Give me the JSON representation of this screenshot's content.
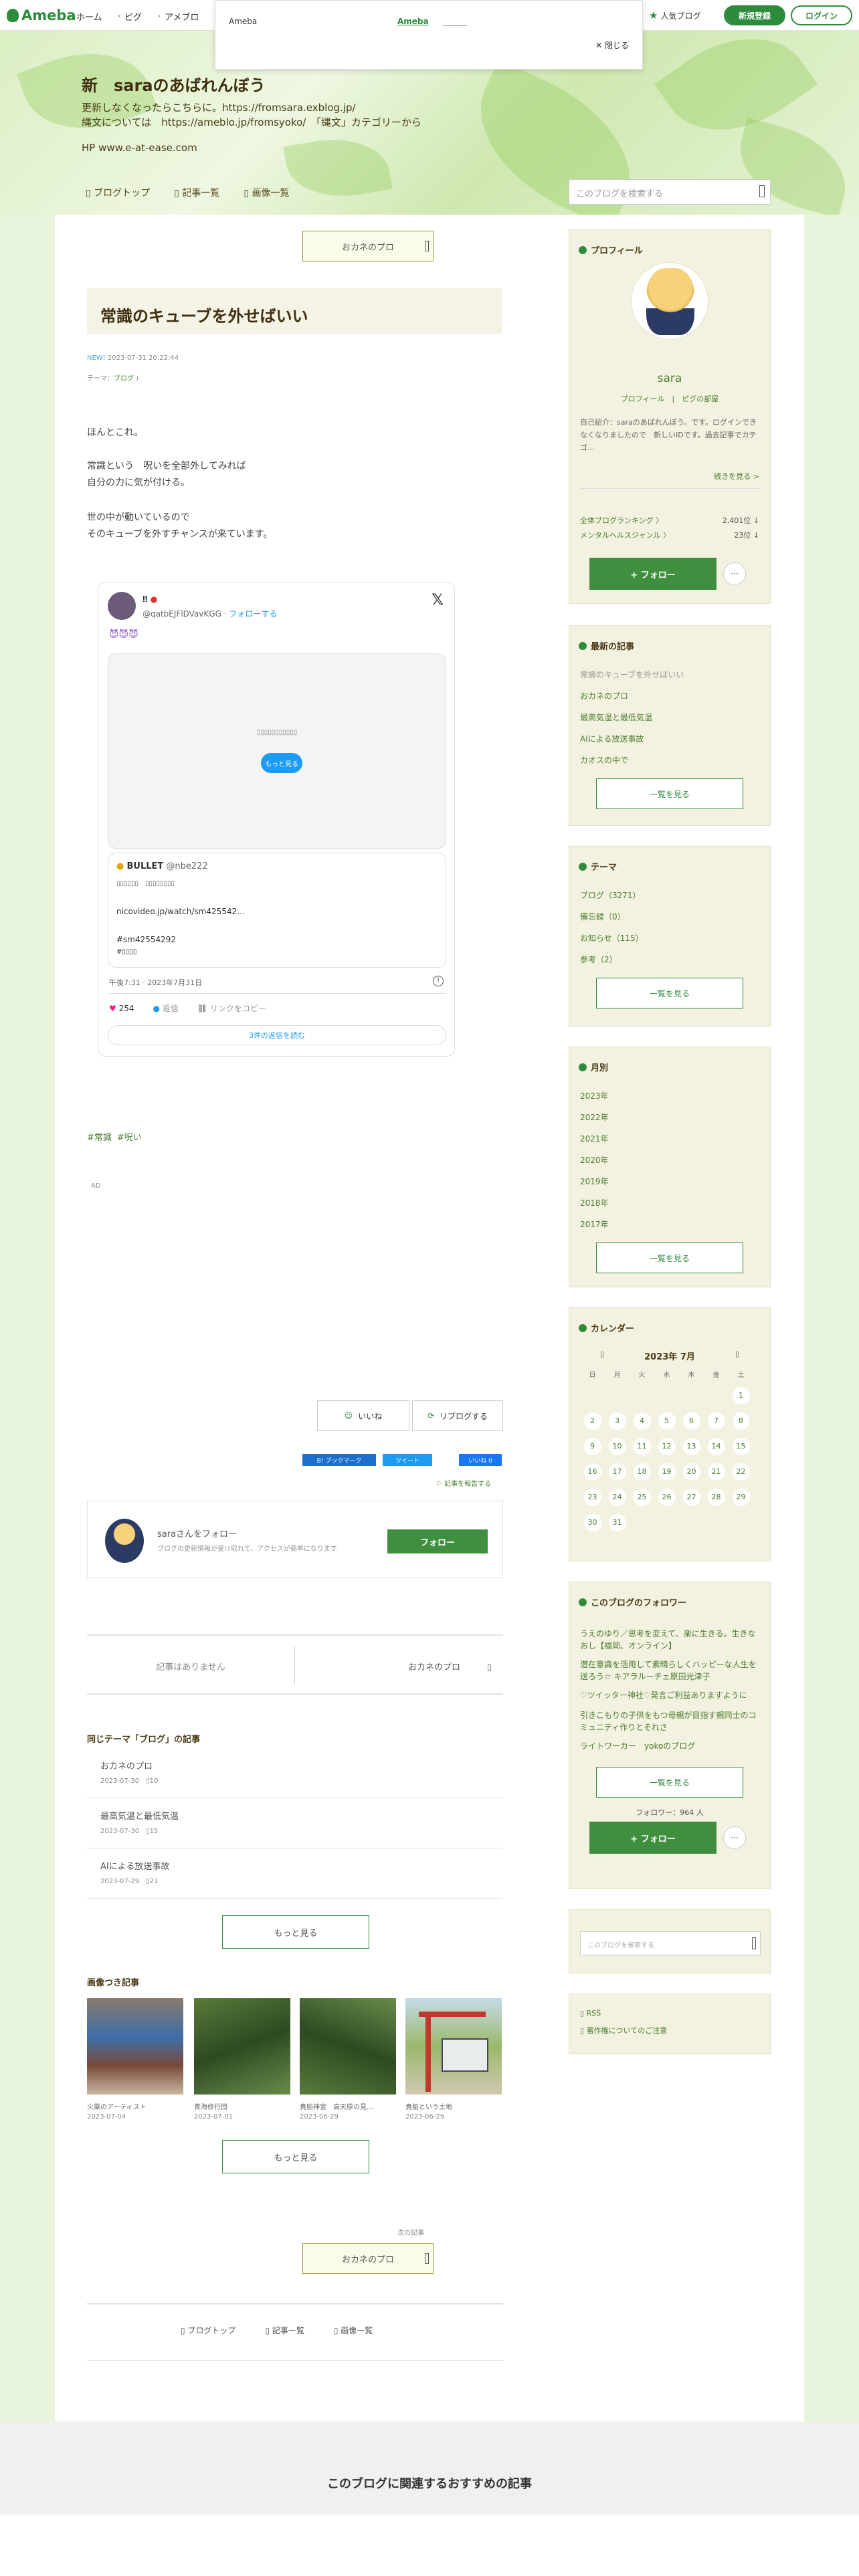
{
  "topbar": {
    "logo": "Ameba",
    "nav": [
      "ホーム",
      "ピグ",
      "アメブロ"
    ],
    "hot_blog": "人気ブログ",
    "signup": "新規登録",
    "login": "ログイン"
  },
  "popover": {
    "label": "Ameba",
    "link": "Ameba",
    "close": "✕ 閉じる"
  },
  "header": {
    "title": "新　saraのあばれんぼう",
    "desc1": "更新しなくなったらこちらに。https://fromsara.exblog.jp/",
    "desc2": "縄文については　https://ameblo.jp/fromsyoko/　「縄文」カテゴリーから",
    "desc3": "HP www.e-at-ease.com",
    "nav": [
      "ブログトップ",
      "記事一覧",
      "画像一覧"
    ],
    "search_placeholder": "このブログを検索する"
  },
  "article": {
    "prev_next_top": "おカネのプロ",
    "title": "常識のキューブを外せばいい",
    "date_label": "NEW!",
    "date": "2023-07-31 20:22:44",
    "theme_label": "テーマ：",
    "theme": "ブログ",
    "body": [
      "ほんとこれ。",
      "常識という　呪いを全部外してみれば",
      "自分の力に気が付ける。",
      "世の中が動いているので",
      "そのキューブを外すチャンスが来ています。"
    ],
    "hashtags": [
      "#常識",
      "#呪い"
    ],
    "ad": "AD"
  },
  "tweet": {
    "user_name": "‼",
    "user_handle": "@qatbEJFlDVavKGG",
    "follow": "フォローする",
    "text": "",
    "cta": "もっと見る",
    "quote_name": "BULLET",
    "quote_handle": "@nbe222",
    "quote_line1": "",
    "quote_link": "nicovideo.jp/watch/sm425542…",
    "quote_tag1": "#sm42554292",
    "quote_tag2": "#",
    "time": "午後7:31 · 2023年7月31日",
    "likes": "254",
    "reply": "返信",
    "share": "リンクをコピー",
    "read_replies": "3件の返信を読む"
  },
  "actions": {
    "like": "いいね",
    "reblog": "リブログする",
    "bookmark": "B! ブックマーク",
    "tweet": "ツイート",
    "fb": "いいね 0",
    "report": "記事を報告する"
  },
  "follow_box": {
    "title": "saraさんをフォロー",
    "desc": "ブログの更新情報が受け取れて、アクセスが簡単になります",
    "button": "フォロー"
  },
  "pager": {
    "none": "記事はありません",
    "next": "おカネのプロ"
  },
  "same_theme": {
    "heading": "同じテーマ「ブログ」の記事",
    "items": [
      {
        "title": "おカネのプロ",
        "date": "2023-07-30",
        "count": "10"
      },
      {
        "title": "最高気温と最低気温",
        "date": "2023-07-30",
        "count": "15"
      },
      {
        "title": "AIによる放送事故",
        "date": "2023-07-29",
        "count": "21"
      }
    ],
    "more": "もっと見る"
  },
  "image_articles": {
    "heading": "画像つき記事",
    "items": [
      {
        "title": "火薬のアーティスト",
        "date": "2023-07-04"
      },
      {
        "title": "青海修行団",
        "date": "2023-07-01"
      },
      {
        "title": "貴船神宮　高天原の見…",
        "date": "2023-06-29"
      },
      {
        "title": "貴船という土地",
        "date": "2023-06-29"
      }
    ],
    "more": "もっと見る"
  },
  "bottom": {
    "next_label": "次の記事",
    "next": "おカネのプロ",
    "nav": [
      "ブログトップ",
      "記事一覧",
      "画像一覧"
    ]
  },
  "recommend": "このブログに関連するおすすめの記事",
  "profile": {
    "heading": "プロフィール",
    "name": "sara",
    "links": [
      "プロフィール",
      "ピグの部屋"
    ],
    "intro": "自己紹介：saraのあばれんぼう。です。ログインできなくなりましたので　新しいIDです。過去記事でカテゴ…",
    "more": "続きを見る >",
    "rank1_label": "全体ブログランキング",
    "rank1": "2,401位",
    "rank2_label": "メンタルヘルスジャンル",
    "rank2": "23位",
    "follow": "+ フォロー",
    "dots": "···"
  },
  "recent": {
    "heading": "最新の記事",
    "items": [
      "常識のキューブを外せばいい",
      "おカネのプロ",
      "最高気温と最低気温",
      "AIによる放送事故",
      "カオスの中で"
    ],
    "more": "一覧を見る"
  },
  "themes": {
    "heading": "テーマ",
    "items": [
      "ブログ（3271）",
      "備忘録（0）",
      "お知らせ（115）",
      "参考（2）"
    ],
    "more": "一覧を見る"
  },
  "monthly": {
    "heading": "月別",
    "items": [
      "2023年",
      "2022年",
      "2021年",
      "2020年",
      "2019年",
      "2018年",
      "2017年"
    ],
    "more": "一覧を見る"
  },
  "calendar": {
    "heading": "カレンダー",
    "month": "2023年 7月",
    "weekdays": [
      "日",
      "月",
      "火",
      "水",
      "木",
      "金",
      "土"
    ],
    "weeks": [
      [
        "",
        "",
        "",
        "",
        "",
        "",
        "1"
      ],
      [
        "2",
        "3",
        "4",
        "5",
        "6",
        "7",
        "8"
      ],
      [
        "9",
        "10",
        "11",
        "12",
        "13",
        "14",
        "15"
      ],
      [
        "16",
        "17",
        "18",
        "19",
        "20",
        "21",
        "22"
      ],
      [
        "23",
        "24",
        "25",
        "26",
        "27",
        "28",
        "29"
      ],
      [
        "30",
        "31",
        "",
        "",
        "",
        "",
        ""
      ]
    ]
  },
  "followers": {
    "heading": "このブログのフォロワー",
    "items": [
      "うえのゆり／思考を変えて、楽に生きる。生きなおし【福岡、オンライン】",
      "潜在意識を活用して素晴らしくハッピーな人生を送ろう☆ キアラルーチェ原田光津子",
      "♡ツイッター神社♡発言ご利益ありますように",
      "引きこもりの子供をもつ母親が目指す親同士のコミュニティ作りとそれさ",
      "ライトワーカー　yokoのブログ"
    ],
    "more": "一覧を見る",
    "count": "フォロワー：964 人",
    "follow": "+ フォロー",
    "dots": "···"
  },
  "side_search": {
    "placeholder": "このブログを検索する"
  },
  "rss": {
    "rss": "RSS",
    "terms": "著作権についてのご注意"
  }
}
